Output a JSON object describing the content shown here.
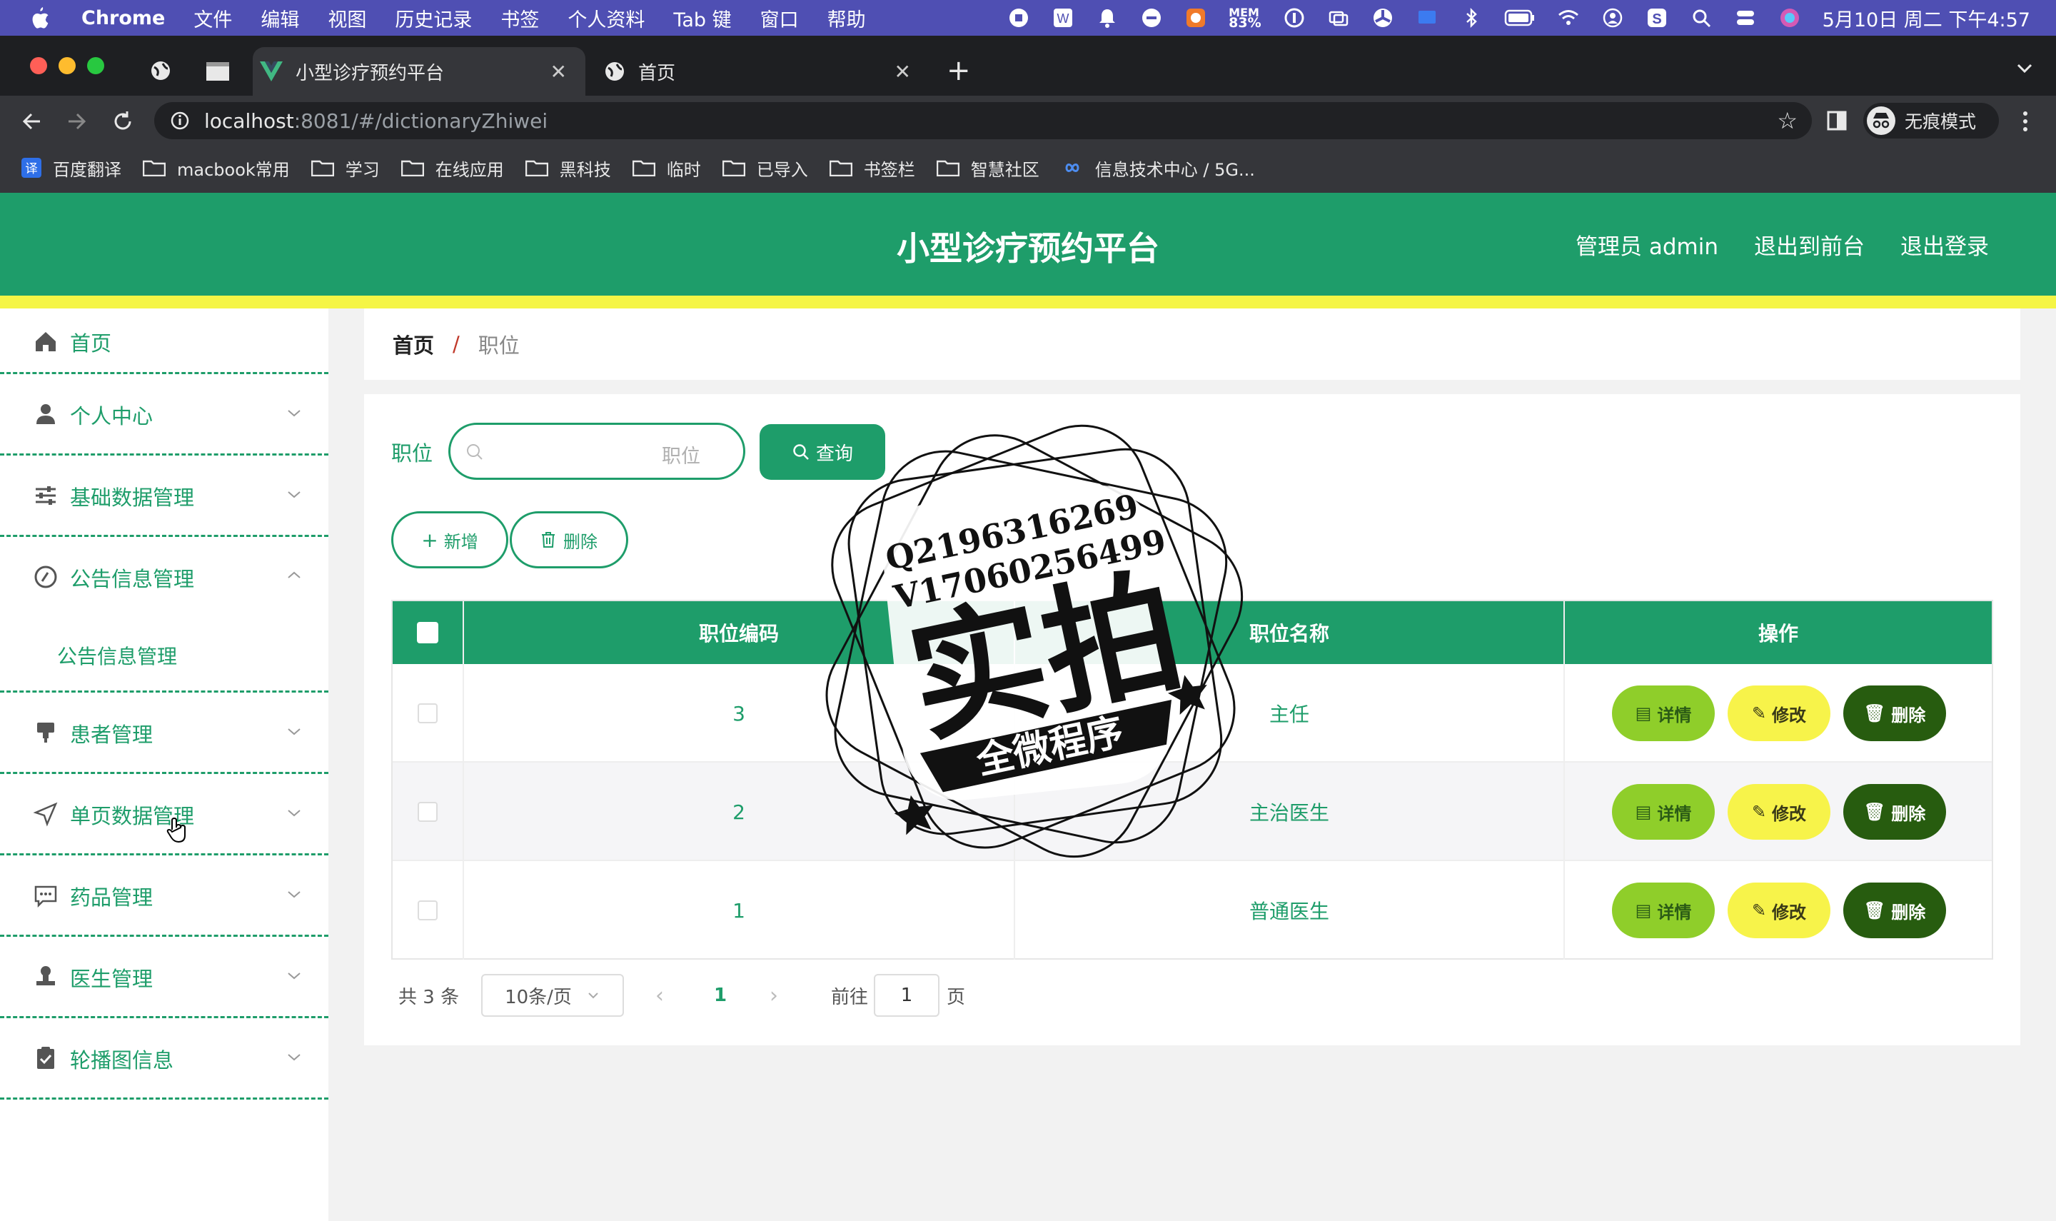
{
  "menubar": {
    "app_name": "Chrome",
    "items": [
      "文件",
      "编辑",
      "视图",
      "历史记录",
      "书签",
      "个人资料",
      "Tab 键",
      "窗口",
      "帮助"
    ],
    "mem_label": "MEM",
    "mem_value": "83%",
    "clock": "5月10日 周二 下午4:57"
  },
  "browser": {
    "tabs": [
      {
        "title": "小型诊疗预约平台",
        "active": true
      },
      {
        "title": "首页",
        "active": false
      }
    ],
    "url_host": "localhost",
    "url_rest": ":8081/#/dictionaryZhiwei",
    "profile_label": "无痕模式",
    "bookmarks": [
      "百度翻译",
      "macbook常用",
      "学习",
      "在线应用",
      "黑科技",
      "临时",
      "已导入",
      "书签栏",
      "智慧社区",
      "信息技术中心 / 5G..."
    ]
  },
  "header": {
    "title": "小型诊疗预约平台",
    "admin": "管理员 admin",
    "to_front": "退出到前台",
    "logout": "退出登录"
  },
  "sidebar": {
    "items": [
      {
        "label": "首页",
        "icon": "home-icon"
      },
      {
        "label": "个人中心",
        "icon": "user-icon"
      },
      {
        "label": "基础数据管理",
        "icon": "sliders-icon"
      },
      {
        "label": "公告信息管理",
        "icon": "notice-icon"
      },
      {
        "label": "患者管理",
        "icon": "stamp-icon"
      },
      {
        "label": "单页数据管理",
        "icon": "send-icon"
      },
      {
        "label": "药品管理",
        "icon": "chat-icon"
      },
      {
        "label": "医生管理",
        "icon": "person-stamp-icon"
      },
      {
        "label": "轮播图信息",
        "icon": "clipboard-icon"
      }
    ],
    "subitem": "公告信息管理"
  },
  "breadcrumb": {
    "home": "首页",
    "sep": "/",
    "current": "职位"
  },
  "search": {
    "label": "职位",
    "placeholder": "职位",
    "query_button": "查询"
  },
  "actions": {
    "add": "新增",
    "delete": "删除"
  },
  "table": {
    "headers": [
      "职位编码",
      "职位名称",
      "操作"
    ],
    "rows": [
      {
        "code": "3",
        "name": "主任"
      },
      {
        "code": "2",
        "name": "主治医生"
      },
      {
        "code": "1",
        "name": "普通医生"
      }
    ],
    "row_actions": {
      "detail": "详情",
      "edit": "修改",
      "delete": "删除"
    }
  },
  "pagination": {
    "total": "共 3 条",
    "page_size": "10条/页",
    "current_page": "1",
    "goto_label": "前往",
    "goto_value": "1",
    "page_suffix": "页"
  },
  "watermark": {
    "line1": "Q2196316269",
    "line2": "V17060256499",
    "big": "实拍",
    "ribbon": "全微程序"
  },
  "colors": {
    "primary": "#1e9d6a",
    "accent_yellow": "#f5f545",
    "detail": "#8fce2a",
    "edit": "#f7f34a",
    "delete": "#275c0f"
  }
}
